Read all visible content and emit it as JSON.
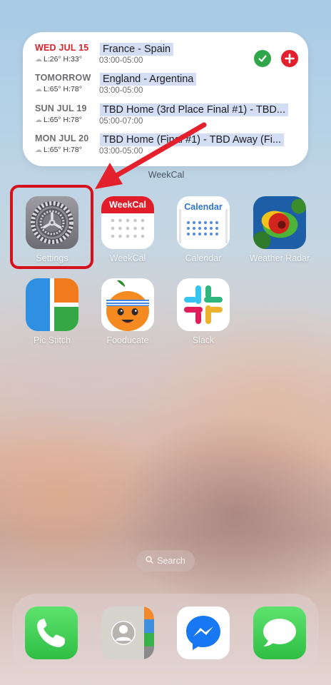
{
  "widget": {
    "caption": "WeekCal",
    "rows": [
      {
        "date": "WED JUL 15",
        "weather": "L:26° H:33°",
        "event": "France - Spain",
        "time": "03:00-05:00",
        "today": true
      },
      {
        "date": "TOMORROW",
        "weather": "L:65° H:78°",
        "event": "England - Argentina",
        "time": "03:00-05:00",
        "today": false
      },
      {
        "date": "SUN JUL 19",
        "weather": "L:65° H:78°",
        "event": "TBD Home (3rd Place Final #1) - TBD...",
        "time": "05:00-07:00",
        "today": false
      },
      {
        "date": "MON JUL 20",
        "weather": "L:65° H:78°",
        "event": "TBD Home (Final #1) - TBD Away (Fi...",
        "time": "03:00-05:00",
        "today": false
      }
    ],
    "check_icon": "checkmark-icon",
    "add_icon": "plus-icon"
  },
  "apps": [
    {
      "name": "Settings",
      "icon": "settings-gear-icon"
    },
    {
      "name": "WeekCal",
      "icon": "weekcal-icon",
      "icon_text": "WeekCal"
    },
    {
      "name": "Calendar",
      "icon": "calendar-icon",
      "icon_text": "Calendar"
    },
    {
      "name": "Weather Radar",
      "icon": "weather-radar-icon"
    },
    {
      "name": "Pic Stitch",
      "icon": "pic-stitch-icon"
    },
    {
      "name": "Fooducate",
      "icon": "fooducate-icon"
    },
    {
      "name": "Slack",
      "icon": "slack-icon"
    }
  ],
  "search": {
    "label": "Search",
    "icon": "search-icon"
  },
  "dock": [
    {
      "name": "Phone",
      "icon": "phone-icon"
    },
    {
      "name": "Contacts",
      "icon": "contacts-icon"
    },
    {
      "name": "Messenger",
      "icon": "messenger-icon"
    },
    {
      "name": "Messages",
      "icon": "messages-icon"
    }
  ],
  "colors": {
    "highlight": "#d5111c",
    "today": "#d8222b",
    "event_bg": "#d3def5",
    "check": "#30a64a",
    "add": "#e4202c"
  }
}
